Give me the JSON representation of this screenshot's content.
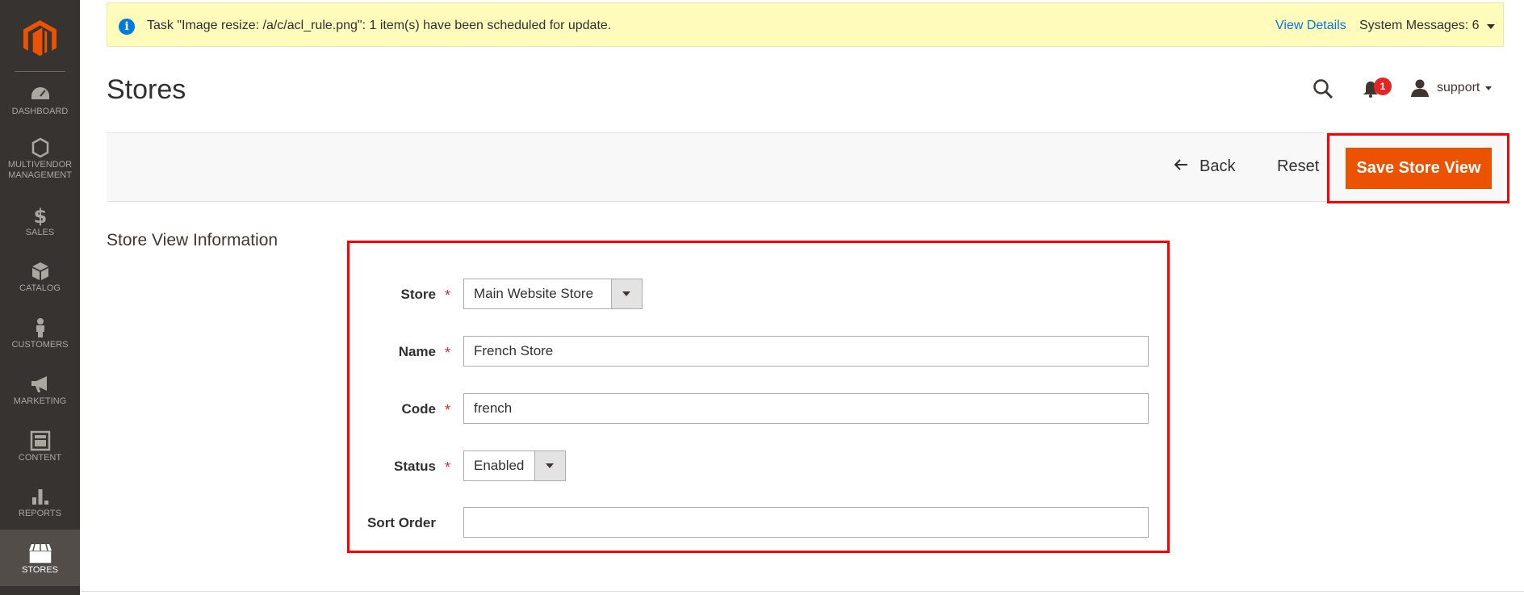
{
  "sidebar": {
    "logo": "magento-logo",
    "items": [
      {
        "label": "DASHBOARD",
        "icon": "dashboard-icon"
      },
      {
        "label": "MULTIVENDOR MANAGEMENT",
        "icon": "hexagon-icon"
      },
      {
        "label": "SALES",
        "icon": "dollar-icon"
      },
      {
        "label": "CATALOG",
        "icon": "cube-icon"
      },
      {
        "label": "CUSTOMERS",
        "icon": "person-icon"
      },
      {
        "label": "MARKETING",
        "icon": "megaphone-icon"
      },
      {
        "label": "CONTENT",
        "icon": "layout-icon"
      },
      {
        "label": "REPORTS",
        "icon": "bar-chart-icon"
      },
      {
        "label": "STORES",
        "icon": "storefront-icon",
        "active": true
      }
    ]
  },
  "system_message": {
    "text": "Task \"Image resize: /a/c/acl_rule.png\": 1 item(s) have been scheduled for update.",
    "view_details": "View Details",
    "system_messages": "System Messages: 6"
  },
  "header": {
    "title": "Stores",
    "notification_count": "1",
    "user": "support"
  },
  "actions": {
    "back": "Back",
    "reset": "Reset",
    "save": "Save Store View"
  },
  "form": {
    "section_title": "Store View Information",
    "store": {
      "label": "Store",
      "value": "Main Website Store"
    },
    "name": {
      "label": "Name",
      "value": "French Store"
    },
    "code": {
      "label": "Code",
      "value": "french"
    },
    "status": {
      "label": "Status",
      "value": "Enabled"
    },
    "sort_order": {
      "label": "Sort Order",
      "value": ""
    },
    "required_mark": "*"
  },
  "colors": {
    "accent": "#eb5202",
    "sidebar_bg": "#373330",
    "message_bg": "#fffbbb",
    "link": "#007bdb",
    "highlight": "#ff0000"
  }
}
